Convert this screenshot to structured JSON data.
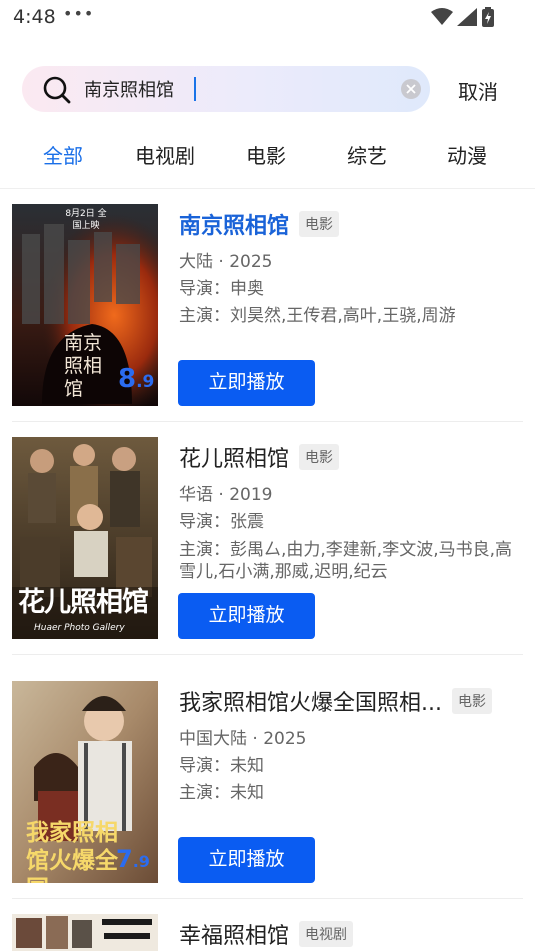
{
  "status": {
    "time": "4:48",
    "dots": "•••"
  },
  "search": {
    "value": "南京照相馆",
    "cancel_label": "取消"
  },
  "tabs": [
    "全部",
    "电视剧",
    "电影",
    "综艺",
    "动漫"
  ],
  "results": [
    {
      "title": "南京照相馆",
      "badge": "电影",
      "region_year": "大陆 · 2025",
      "director": "导演：申奥",
      "cast": "主演：刘昊然,王传君,高叶,王骁,周游",
      "play_label": "立即播放",
      "poster_text": "南京照相馆",
      "poster_date": "8月2日 全国上映",
      "score_major": "8",
      "score_minor": ".9"
    },
    {
      "title": "花儿照相馆",
      "badge": "电影",
      "region_year": "华语 · 2019",
      "director": "导演：张震",
      "cast": "主演：彭禺厶,由力,李建新,李文波,马书良,高雪儿,石小满,那威,迟明,纪云",
      "play_label": "立即播放",
      "poster_text": "花儿照相馆",
      "poster_sub": "Huaer Photo Gallery"
    },
    {
      "title": "我家照相馆火爆全国照相...",
      "badge": "电影",
      "region_year": "中国大陆 · 2025",
      "director": "导演：未知",
      "cast": "主演：未知",
      "play_label": "立即播放",
      "poster_text": "我家照相馆火爆全国",
      "score_major": "7",
      "score_minor": ".9"
    },
    {
      "title": "幸福照相馆",
      "badge": "电视剧"
    }
  ]
}
